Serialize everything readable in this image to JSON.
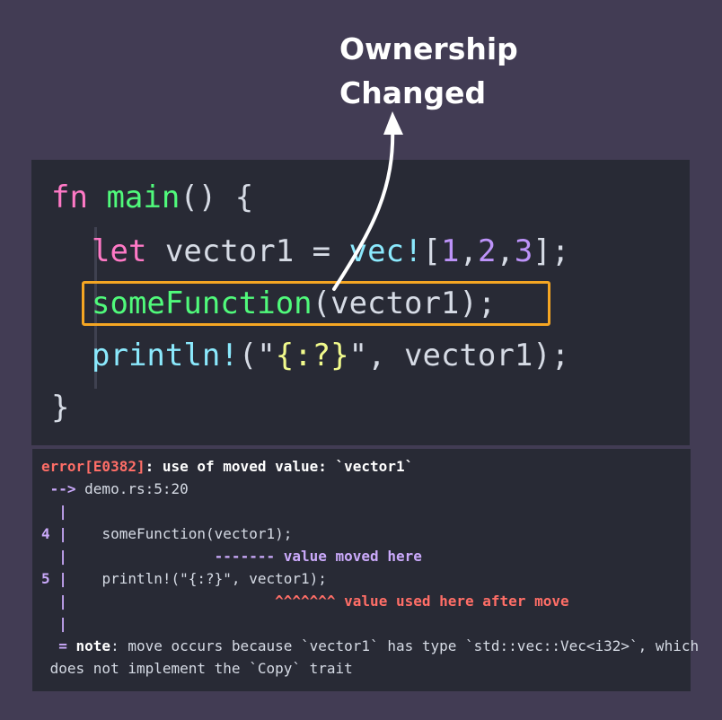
{
  "annotation": {
    "line1": "Ownership",
    "line2": "Changed"
  },
  "code": {
    "line1": {
      "kw": "fn",
      "name": "main",
      "rest": "() {"
    },
    "line2": {
      "kw": "let",
      "ident": " vector1 = ",
      "macro": "vec!",
      "open": "[",
      "n1": "1",
      "c1": ",",
      "n2": "2",
      "c2": ",",
      "n3": "3",
      "close": "];"
    },
    "line3": {
      "fn": "someFunction",
      "rest": "(vector1);"
    },
    "line4": {
      "macro": "println!",
      "open": "(\"",
      "fmt": "{:?}",
      "close": "\", vector1);"
    },
    "line5": {
      "text": "}"
    }
  },
  "error": {
    "header_code": "error[E0382]",
    "header_msg": ": use of moved value: `vector1`",
    "arrow": " -->",
    "location": " demo.rs:5:20",
    "bar": "  |",
    "line4_num": "4 |",
    "line4_code": "    someFunction(vector1);",
    "bar2": "  |",
    "moved_marker": "                 ------- value moved here",
    "line5_num": "5 |",
    "line5_code": "    println!(\"{:?}\", vector1);",
    "bar3": "  |",
    "used_marker": "                        ^^^^^^^ value used here after move",
    "bar4": "  |",
    "note_eq": "  = ",
    "note_label": "note",
    "note_text": ": move occurs because `vector1` has type `std::vec::Vec<i32>`, which",
    "note_text2": " does not implement the `Copy` trait"
  },
  "colors": {
    "background": "#423c54",
    "panel": "#282a35",
    "highlight": "#f5a623",
    "error_red": "#ff6e67",
    "note_purple": "#caa9fa"
  }
}
